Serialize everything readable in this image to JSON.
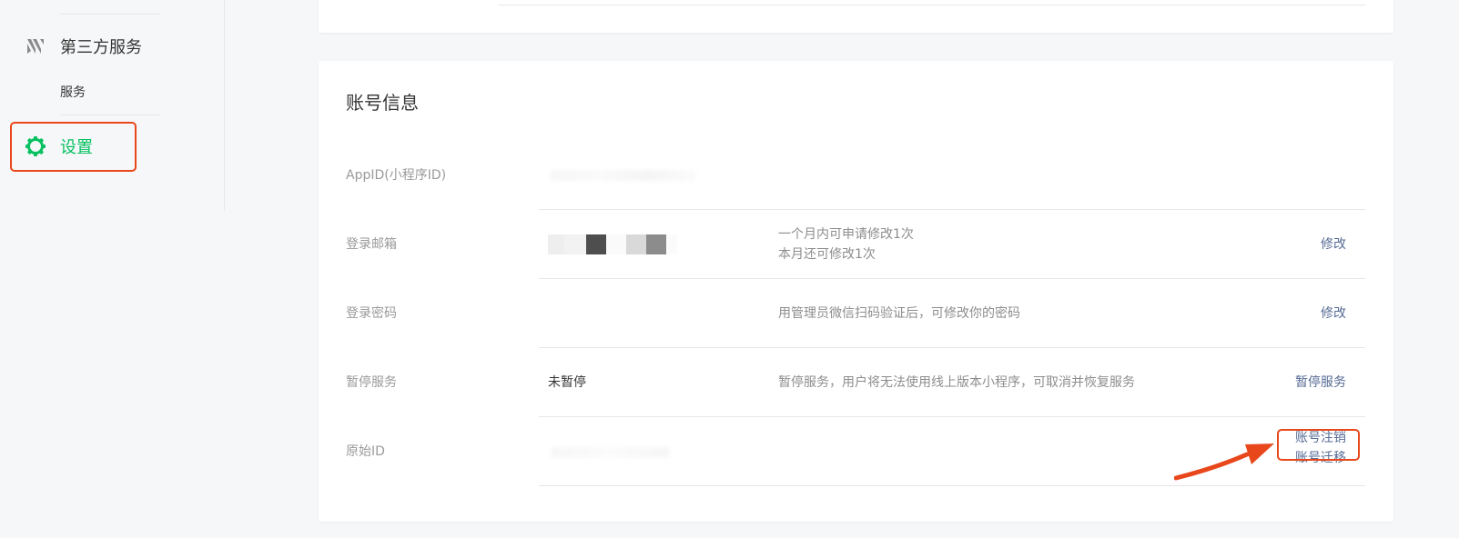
{
  "sidebar": {
    "section_title": "第三方服务",
    "section_icon": "third-party-service-icon",
    "sub_item": "服务",
    "active_item": {
      "label": "设置",
      "icon": "gear-icon"
    }
  },
  "account": {
    "title": "账号信息",
    "rows": [
      {
        "label": "AppID(小程序ID)",
        "value": "",
        "desc": [],
        "actions": []
      },
      {
        "label": "登录邮箱",
        "value": "",
        "desc": [
          "一个月内可申请修改1次",
          "本月还可修改1次"
        ],
        "actions": [
          "修改"
        ]
      },
      {
        "label": "登录密码",
        "value": "",
        "desc": [
          "用管理员微信扫码验证后，可修改你的密码"
        ],
        "actions": [
          "修改"
        ]
      },
      {
        "label": "暂停服务",
        "value": "未暂停",
        "desc": [
          "暂停服务，用户将无法使用线上版本小程序，可取消并恢复服务"
        ],
        "actions": [
          "暂停服务"
        ]
      },
      {
        "label": "原始ID",
        "value": "",
        "desc": [],
        "actions": [
          "账号注销",
          "账号迁移"
        ]
      }
    ]
  },
  "colors": {
    "accent_green": "#07c160",
    "link_blue": "#576b95",
    "highlight_orange": "#e8471b"
  }
}
